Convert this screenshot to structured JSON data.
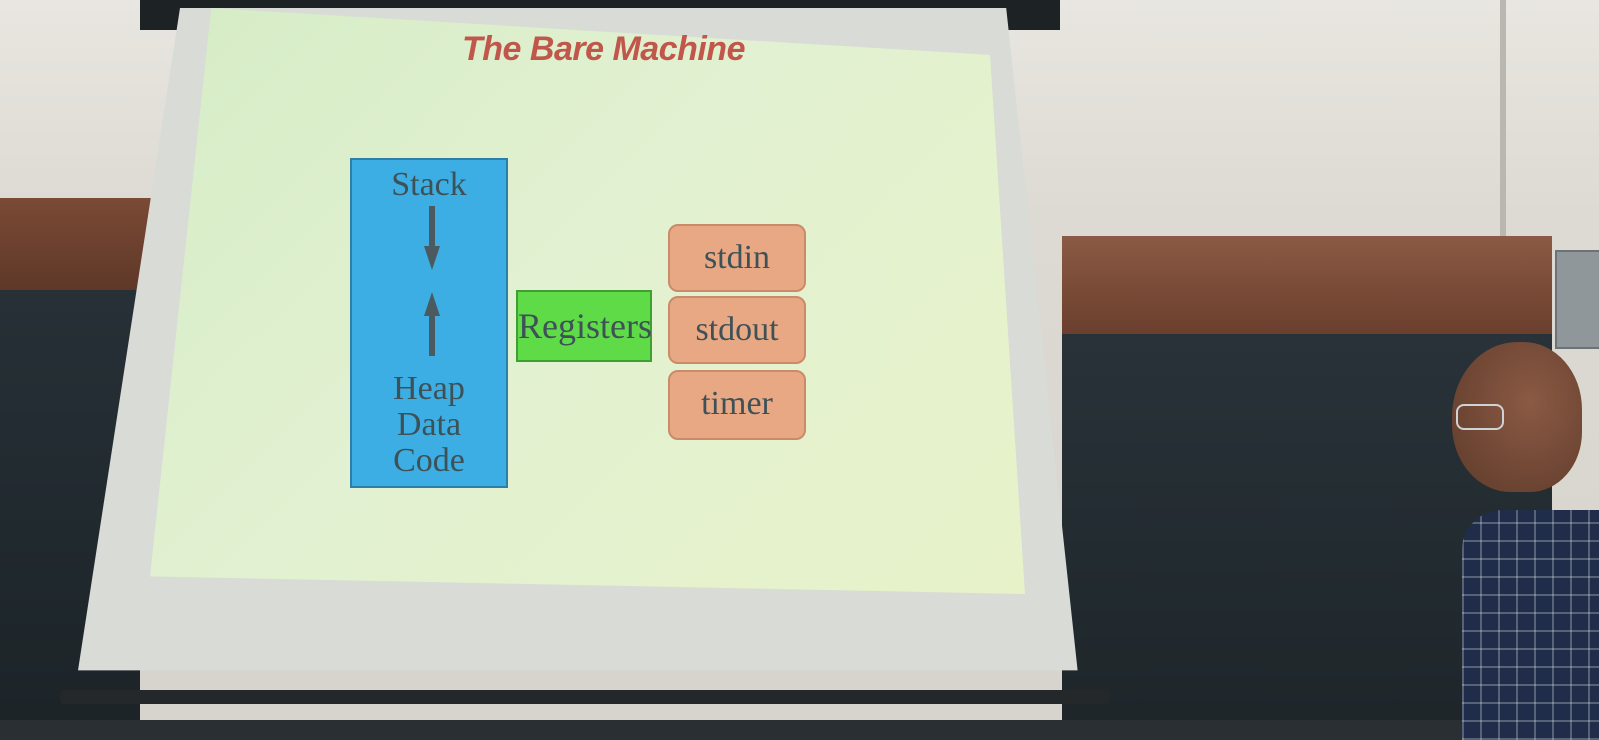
{
  "slide": {
    "title": "The Bare Machine",
    "memory_block": {
      "top_label": "Stack",
      "bottom_labels": [
        "Heap",
        "Data",
        "Code"
      ]
    },
    "registers_label": "Registers",
    "io_devices": [
      "stdin",
      "stdout",
      "timer"
    ]
  },
  "colors": {
    "title": "#c0574a",
    "memory_block": "#3daee3",
    "registers_block": "#5fdb48",
    "io_block": "#e8a884",
    "slide_background": "#dff0cc"
  },
  "icons": [
    "arrow-down-icon",
    "arrow-up-icon"
  ]
}
